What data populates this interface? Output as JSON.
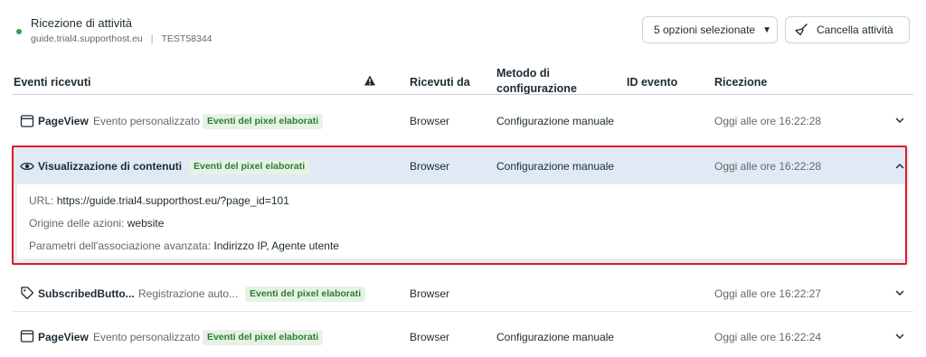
{
  "header": {
    "title": "Ricezione di attività",
    "domain": "guide.trial4.supporthost.eu",
    "separator": "|",
    "pixel_id": "TEST58344",
    "options_label": "5 opzioni selezionate",
    "clear_label": "Cancella attività"
  },
  "columns": {
    "events": "Eventi ricevuti",
    "warning_icon": "warning-icon",
    "received_from": "Ricevuti da",
    "method_line1": "Metodo di",
    "method_line2": "configurazione",
    "event_id": "ID evento",
    "reception": "Ricezione"
  },
  "rows": [
    {
      "icon": "browser-window-icon",
      "name": "PageView",
      "type": "Evento personalizzato",
      "badge": "Eventi del pixel elaborati",
      "source": "Browser",
      "method": "Configurazione manuale",
      "time": "Oggi alle ore 16:22:28",
      "expanded": false
    },
    {
      "icon": "eye-icon",
      "name": "Visualizzazione di contenuti",
      "type": "",
      "badge": "Eventi del pixel elaborati",
      "source": "Browser",
      "method": "Configurazione manuale",
      "time": "Oggi alle ore 16:22:28",
      "expanded": true,
      "details": [
        {
          "key": "URL: ",
          "value": "https://guide.trial4.supporthost.eu/?page_id=101"
        },
        {
          "key": "Origine delle azioni: ",
          "value": "website"
        },
        {
          "key": "Parametri dell'associazione avanzata: ",
          "value": "Indirizzo IP, Agente utente"
        }
      ]
    },
    {
      "icon": "tag-icon",
      "name": "SubscribedButto...",
      "type": "Registrazione auto...",
      "badge": "Eventi del pixel elaborati",
      "source": "Browser",
      "method": "",
      "time": "Oggi alle ore 16:22:27",
      "expanded": false
    },
    {
      "icon": "browser-window-icon",
      "name": "PageView",
      "type": "Evento personalizzato",
      "badge": "Eventi del pixel elaborati",
      "source": "Browser",
      "method": "Configurazione manuale",
      "time": "Oggi alle ore 16:22:24",
      "expanded": false
    }
  ],
  "colors": {
    "accent_red": "#e01b24",
    "status_green": "#31a24c",
    "badge_bg": "#e6f2e6",
    "badge_text": "#2d7d32",
    "highlight_bg": "#e0eaf4"
  }
}
